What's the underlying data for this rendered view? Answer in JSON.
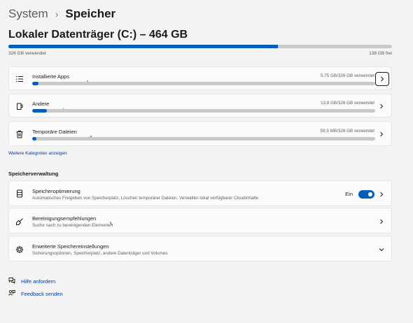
{
  "breadcrumb": {
    "parent": "System",
    "separator": "›",
    "current": "Speicher"
  },
  "drive": {
    "title": "Lokaler Datenträger (C:) – 464 GB",
    "used_label": "326 GB verwendet",
    "free_label": "138 GB frei",
    "used_fraction": 0.703
  },
  "categories": [
    {
      "label": "Installierte Apps",
      "value": "5,75 GB/326 GB verwendet",
      "icon": "apps-list-icon",
      "fraction": 0.018
    },
    {
      "label": "Andere",
      "value": "13,8 GB/326 GB verwendet",
      "icon": "file-other-icon",
      "fraction": 0.042
    },
    {
      "label": "Temporäre Dateien",
      "value": "59,5 MB/326 GB verwendet",
      "icon": "trash-icon",
      "fraction": 0.0002
    }
  ],
  "more_categories_link": "Weitere Kategorien anzeigen",
  "management": {
    "section_title": "Speicherverwaltung",
    "items": [
      {
        "title": "Speicheroptimierung",
        "subtitle": "Automatisches Freigeben von Speicherplatz, Löschen temporärer Dateien, Verwalten lokal verfügbarer Cloudinhalte",
        "toggle_label": "Ein",
        "toggle_on": true
      },
      {
        "title": "Bereinigungsempfehlungen",
        "subtitle": "Suche nach zu bereinigenden Elementen"
      },
      {
        "title": "Erweiterte Speichereinstellungen",
        "subtitle": "Sicherungsoptionen, Speicherplatz, andere Datenträger und Volumes"
      }
    ]
  },
  "help": {
    "get_help": "Hilfe anfordern",
    "feedback": "Feedback senden"
  },
  "colors": {
    "accent": "#005fb8",
    "bar_track": "#c9c9c9",
    "link": "#003e92"
  }
}
